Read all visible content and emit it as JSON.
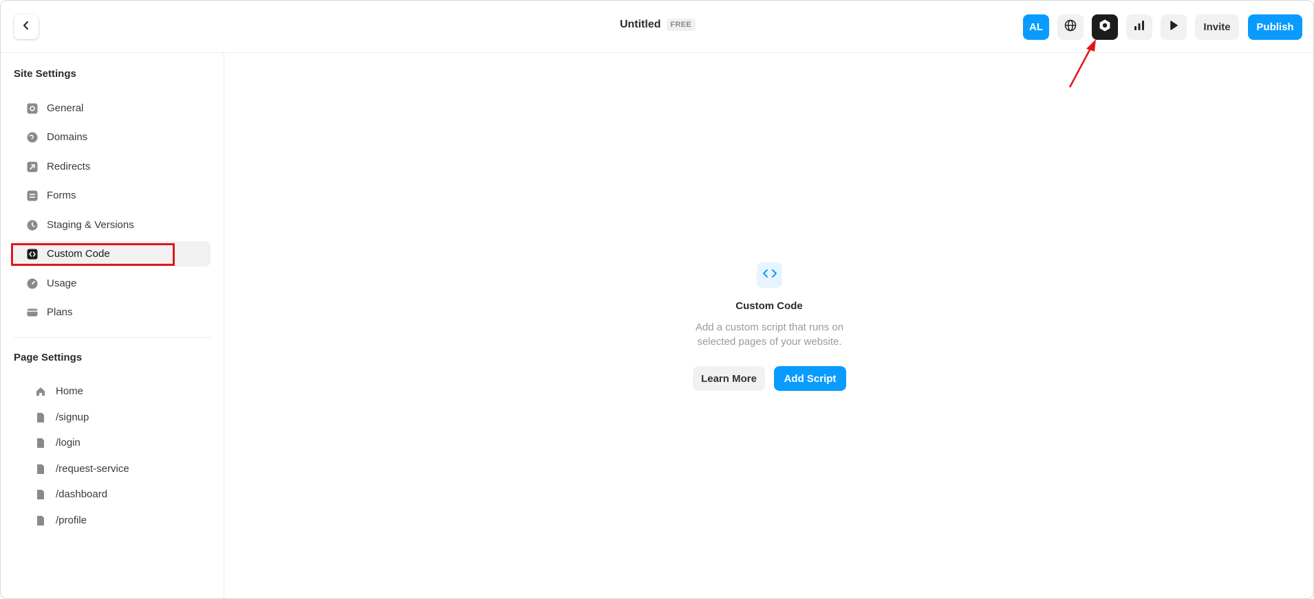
{
  "header": {
    "site_title": "Untitled",
    "plan_badge": "FREE",
    "avatar_initials": "AL",
    "invite_label": "Invite",
    "publish_label": "Publish"
  },
  "sidebar": {
    "site_settings_title": "Site Settings",
    "site_items": [
      {
        "label": "General",
        "icon": "settings-icon"
      },
      {
        "label": "Domains",
        "icon": "globe-icon"
      },
      {
        "label": "Redirects",
        "icon": "redirect-arrow-icon"
      },
      {
        "label": "Forms",
        "icon": "form-icon"
      },
      {
        "label": "Staging & Versions",
        "icon": "clock-icon"
      },
      {
        "label": "Custom Code",
        "icon": "code-icon",
        "active": true
      },
      {
        "label": "Usage",
        "icon": "gauge-icon"
      },
      {
        "label": "Plans",
        "icon": "card-icon"
      }
    ],
    "page_settings_title": "Page Settings",
    "page_items": [
      {
        "label": "Home",
        "icon": "home-icon"
      },
      {
        "label": "/signup",
        "icon": "page-icon"
      },
      {
        "label": "/login",
        "icon": "page-icon"
      },
      {
        "label": "/request-service",
        "icon": "page-icon"
      },
      {
        "label": "/dashboard",
        "icon": "page-icon"
      },
      {
        "label": "/profile",
        "icon": "page-icon"
      }
    ]
  },
  "main": {
    "empty_title": "Custom Code",
    "empty_desc": "Add a custom script that runs on selected pages of your website.",
    "learn_more_label": "Learn More",
    "add_script_label": "Add Script"
  },
  "colors": {
    "accent": "#0a9bff",
    "annotation": "#e0161b",
    "dark_button": "#1c1c1c"
  }
}
